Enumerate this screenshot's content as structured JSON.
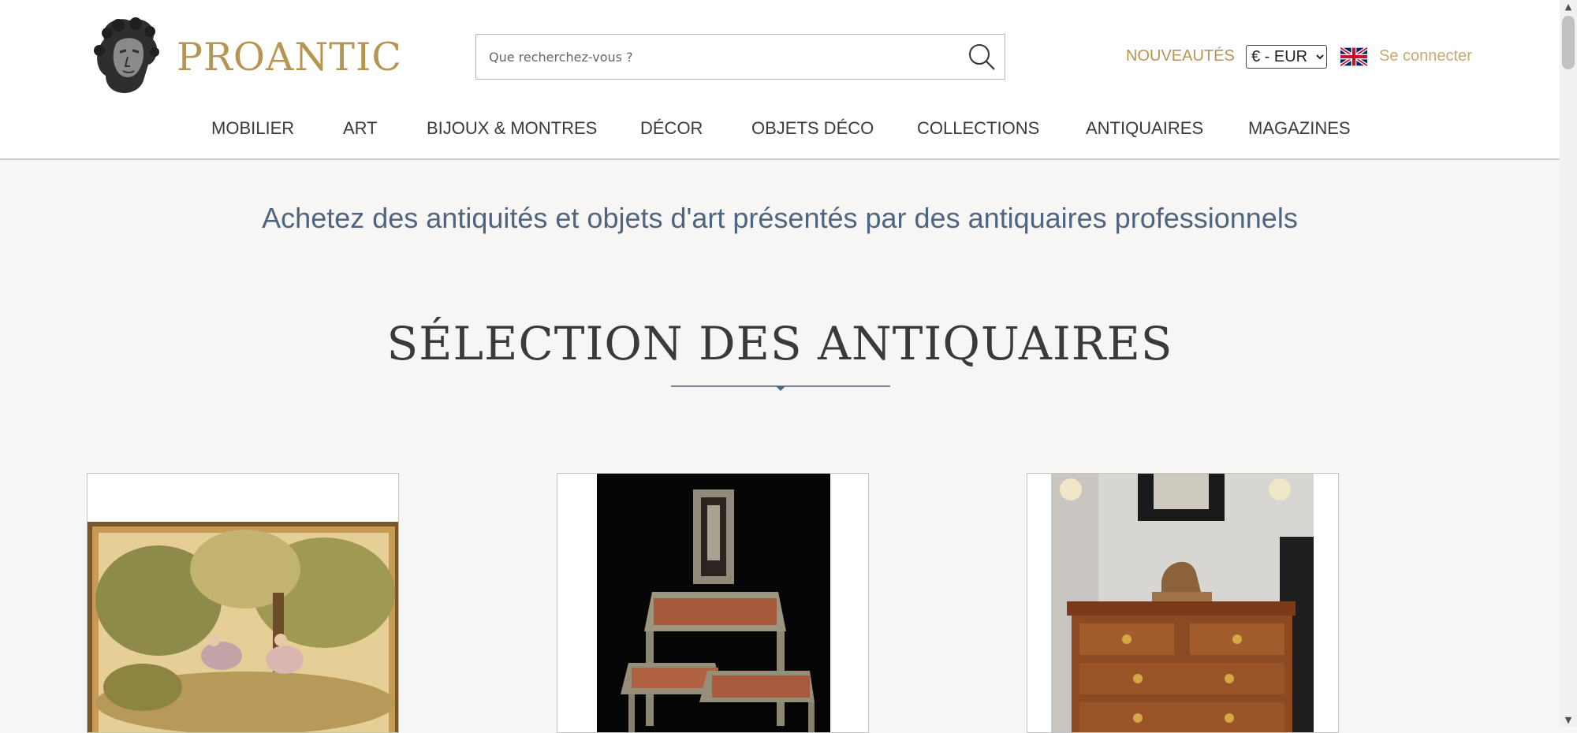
{
  "brand": {
    "name": "PROANTIC",
    "gold": "#b69552",
    "accent_blue": "#4e6582"
  },
  "header": {
    "search": {
      "placeholder": "Que recherchez-vous ?",
      "value": ""
    },
    "nouveautes_label": "NOUVEAUTÉS",
    "currency": {
      "selected": "€ - EUR",
      "options": [
        "€ - EUR"
      ]
    },
    "language_flag": "uk-flag-icon",
    "login_label": "Se connecter"
  },
  "nav": {
    "items": [
      {
        "label": "MOBILIER"
      },
      {
        "label": "ART"
      },
      {
        "label": "BIJOUX & MONTRES"
      },
      {
        "label": "DÉCOR"
      },
      {
        "label": "OBJETS DÉCO"
      },
      {
        "label": "COLLECTIONS"
      },
      {
        "label": "ANTIQUAIRES"
      },
      {
        "label": "MAGAZINES"
      }
    ]
  },
  "main": {
    "tagline": "Achetez des antiquités et objets d'art présentés par des antiquaires professionnels",
    "section_title": "SÉLECTION DES ANTIQUAIRES",
    "products": [
      {
        "image": "tapestry-image"
      },
      {
        "image": "chairs-image"
      },
      {
        "image": "commode-image"
      }
    ]
  },
  "icons": {
    "search": "search-icon",
    "logo": "bust-logo-icon",
    "divider": "diamond-divider-icon"
  }
}
